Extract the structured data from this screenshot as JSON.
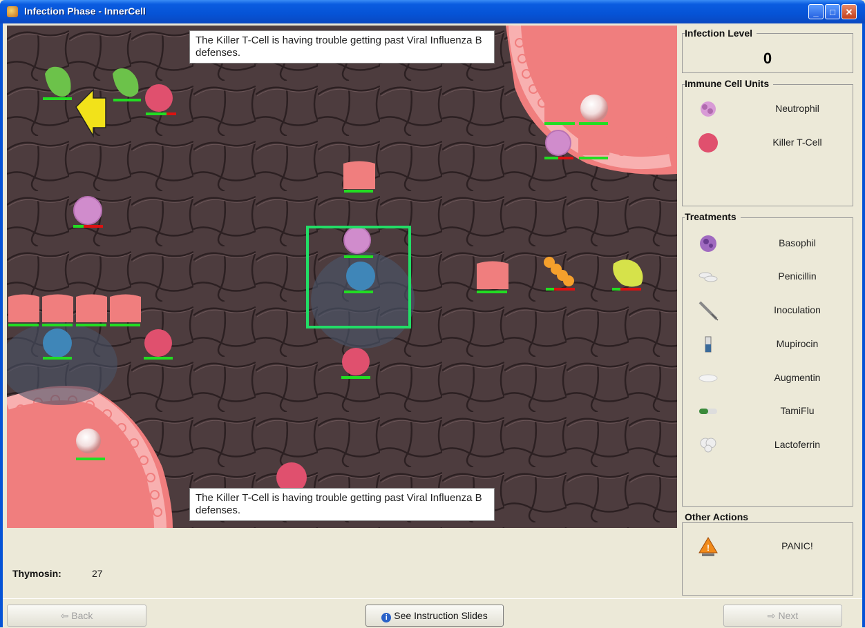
{
  "window": {
    "title": "Infection Phase - InnerCell",
    "minimize_glyph": "_",
    "maximize_glyph": "□",
    "close_glyph": "✕"
  },
  "messages": {
    "top": "The Killer T-Cell is having trouble getting past Viral Influenza B defenses.",
    "bottom": "The Killer T-Cell is having trouble getting past Viral Influenza B defenses."
  },
  "infection": {
    "heading": "Infection Level",
    "value": "0"
  },
  "immune_units": {
    "heading": "Immune Cell Units",
    "items": [
      {
        "label": "Neutrophil",
        "icon": "neutrophil-icon"
      },
      {
        "label": "Killer T-Cell",
        "icon": "killer-t-cell-icon"
      }
    ]
  },
  "treatments": {
    "heading": "Treatments",
    "items": [
      {
        "label": "Basophil",
        "icon": "basophil-icon"
      },
      {
        "label": "Penicillin",
        "icon": "penicillin-icon"
      },
      {
        "label": "Inoculation",
        "icon": "syringe-icon"
      },
      {
        "label": "Mupirocin",
        "icon": "vial-icon"
      },
      {
        "label": "Augmentin",
        "icon": "capsule-icon"
      },
      {
        "label": "TamiFlu",
        "icon": "pill-icon"
      },
      {
        "label": "Lactoferrin",
        "icon": "lactoferrin-icon"
      }
    ]
  },
  "other_actions": {
    "heading": "Other Actions",
    "items": [
      {
        "label": "PANIC!",
        "icon": "warning-icon"
      }
    ]
  },
  "status": {
    "thymosin_label": "Thymosin:",
    "thymosin_value": "27"
  },
  "buttons": {
    "back": "Back",
    "instructions": "See Instruction Slides",
    "next": "Next"
  },
  "colors": {
    "tissue": "#4a3a3c",
    "cell_pink": "#f07e7e",
    "killer_t_cell": "#e0506e",
    "health_green": "#22dd22",
    "damage_red": "#dd1111",
    "selection_green": "#22dd66",
    "blue_cell": "#3f86b8"
  }
}
